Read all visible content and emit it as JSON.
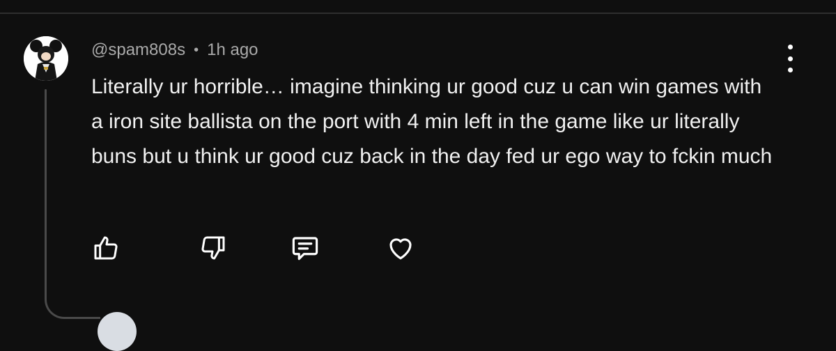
{
  "comment": {
    "author": "@spam808s",
    "separator": "•",
    "timestamp": "1h ago",
    "text": "Literally ur horrible… imagine thinking ur good cuz u can win games with a iron site ballista on the port with 4 min left in the game like ur literally buns but u think ur good cuz back in the day fed ur ego way to fckin much"
  },
  "actions": {
    "like_icon": "thumbs-up-icon",
    "dislike_icon": "thumbs-down-icon",
    "reply_icon": "comment-bubble-icon",
    "heart_icon": "heart-icon",
    "menu_icon": "more-vertical-icon"
  },
  "colors": {
    "background": "#0f0f0f",
    "text": "#f1f1f1",
    "meta": "#aaaaaa",
    "thread_line": "#4a4a4a"
  }
}
